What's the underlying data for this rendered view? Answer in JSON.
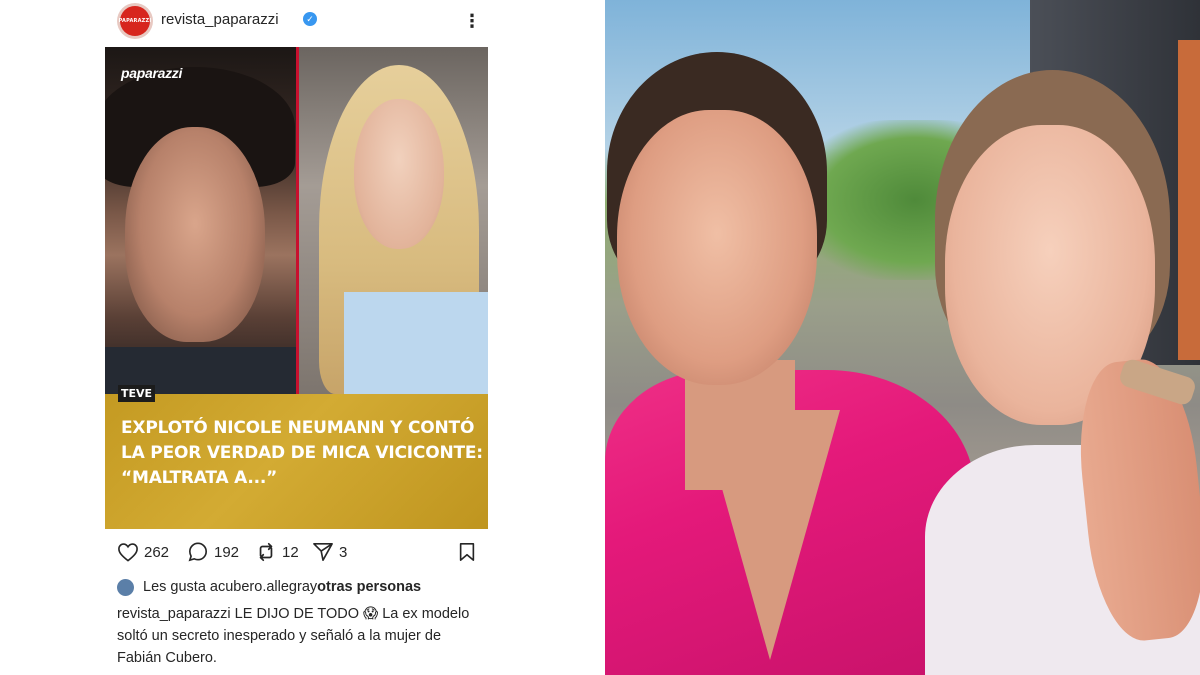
{
  "post": {
    "username": "revista_paparazzi",
    "avatar_text": "PAPARAZZI",
    "more": "⋮",
    "brand": "paparazzi",
    "tag": "TEVE",
    "headline": [
      "EXPLOTÓ NICOLE NEUMANN Y CONTÓ",
      "LA PEOR VERDAD DE MICA VICICONTE:",
      "“MALTRATA A...”"
    ],
    "likes_count": "262",
    "comments_count": "192",
    "reposts_count": "12",
    "shares_count": "3",
    "liked_by_prefix": "Les gusta a ",
    "liked_by_user": "cubero.allegra",
    "liked_by_mid": " y ",
    "liked_by_others": "otras personas",
    "caption_user": "revista_paparazzi",
    "caption_text": " LE DIJO DE TODO 😱 La ex modelo soltó un secreto inesperado y señaló a la mujer de Fabián Cubero."
  },
  "colors": {
    "verified": "#3897f0",
    "banner": "#c9a02a",
    "divider": "#c8102e",
    "dress": "#e4197a"
  }
}
